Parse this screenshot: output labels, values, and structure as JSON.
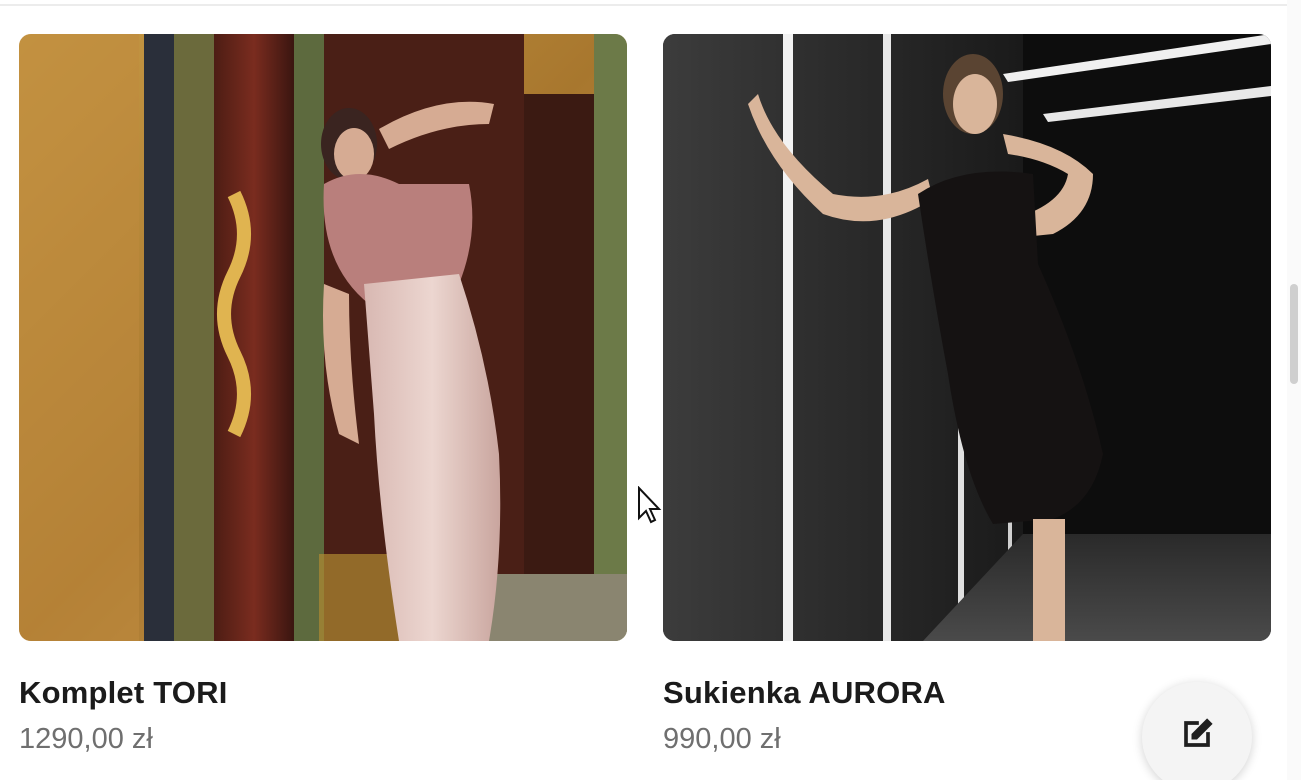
{
  "products": [
    {
      "title": "Komplet TORI",
      "price": "1290,00 zł",
      "image_desc": "model-pink-gown-ornate-interior"
    },
    {
      "title": "Sukienka AURORA",
      "price": "990,00 zł",
      "image_desc": "model-black-velvet-dress-light-corridor"
    }
  ],
  "fab": {
    "icon": "edit-icon"
  },
  "colors": {
    "title": "#1b1b1b",
    "price": "#6f6f6f",
    "fab_bg": "#f4f4f4"
  }
}
